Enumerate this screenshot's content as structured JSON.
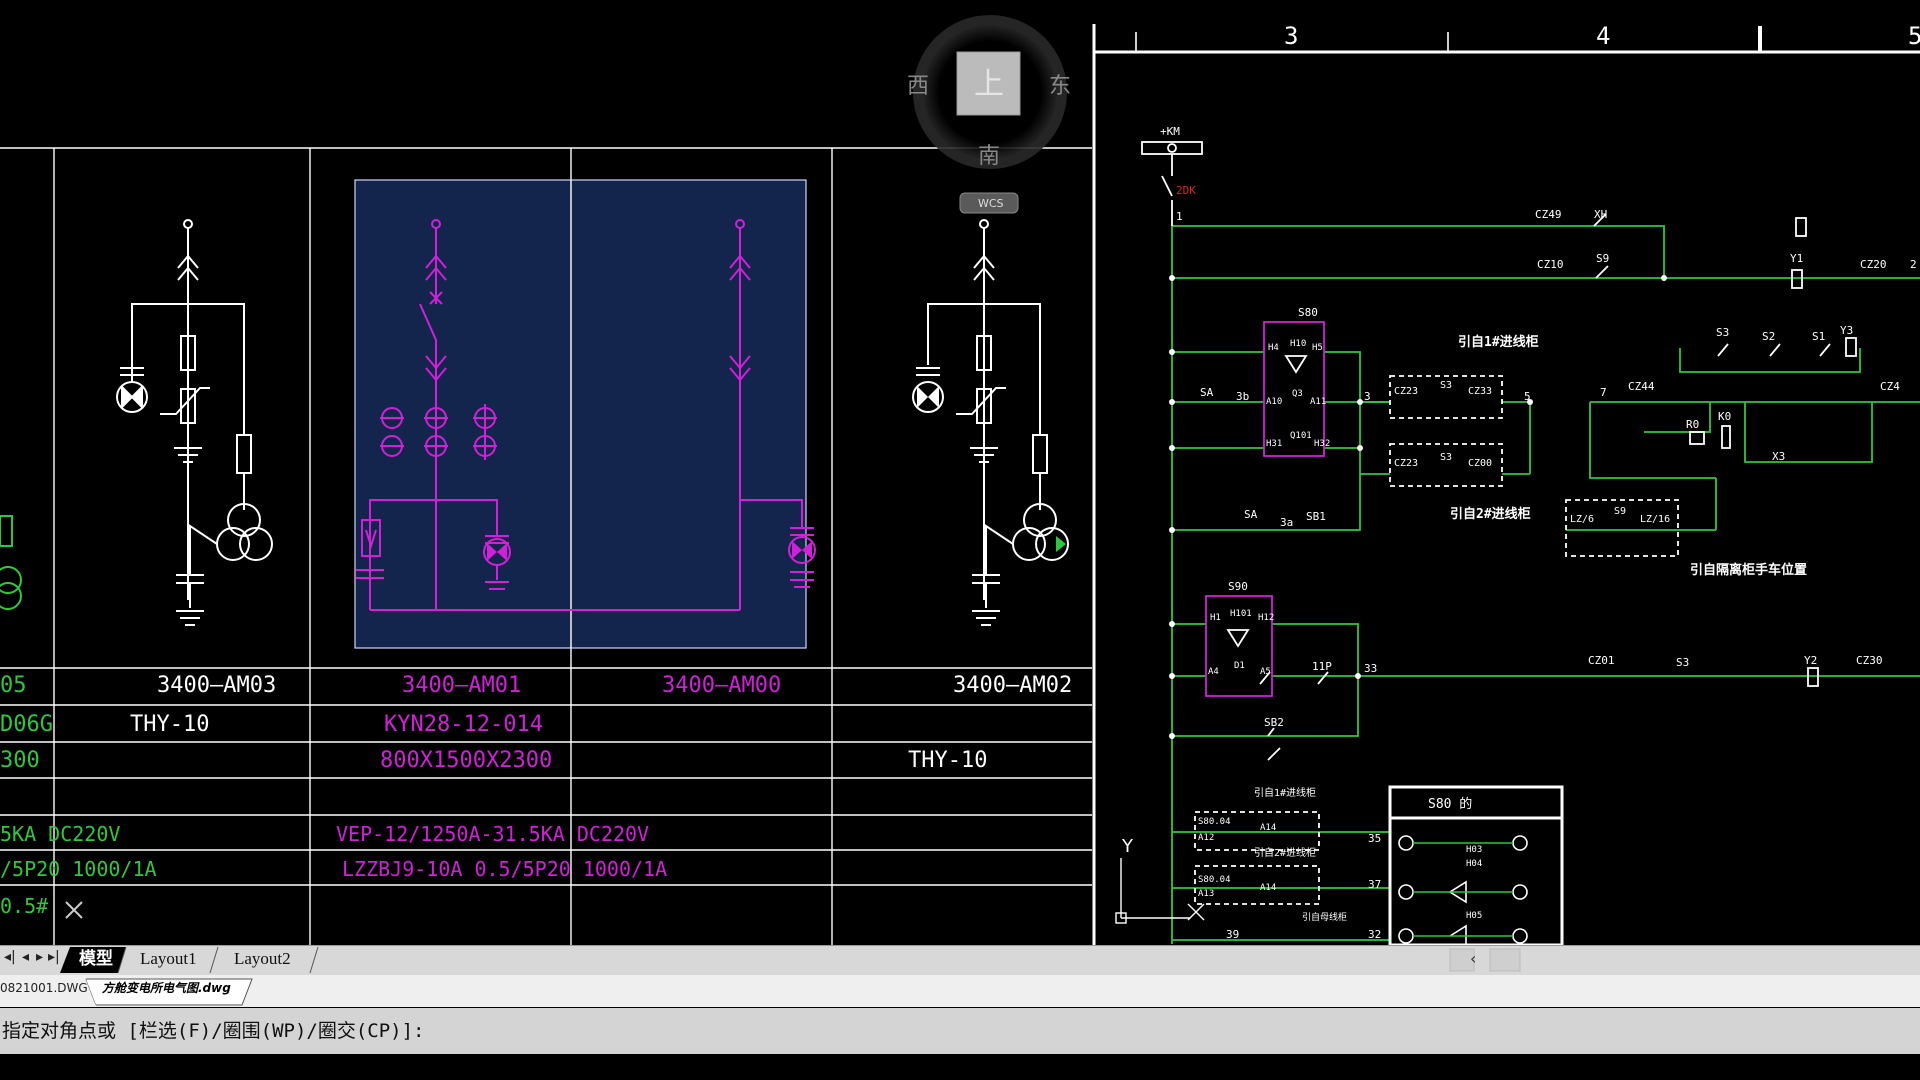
{
  "viewcube": {
    "top_label": "上",
    "west": "西",
    "east": "东",
    "south": "南",
    "wcs": "WCS"
  },
  "ruler": {
    "labels": [
      "3",
      "4",
      "5"
    ]
  },
  "panels": {
    "row1": [
      "05",
      "3400—AM03",
      "3400—AM01",
      "3400—AM00",
      "3400—AM02"
    ],
    "row2": [
      "D06G",
      "THY-10",
      "KYN28-12-014"
    ],
    "row3": [
      "300",
      "800X1500X2300",
      "THY-10"
    ],
    "row5": [
      "5KA DC220V",
      "VEP-12/1250A-31.5KA DC220V"
    ],
    "row6": [
      "/5P20 1000/1A",
      "LZZBJ9-10A 0.5/5P20 1000/1A"
    ],
    "row7": [
      "0.5#"
    ]
  },
  "schematic": {
    "supply": "+KM",
    "fuse": "2DK",
    "node1": "1",
    "labels": {
      "cz49": "CZ49",
      "xh": "XH",
      "cz10": "CZ10",
      "s9a": "S9",
      "y1": "Y1",
      "cz20": "CZ20",
      "e2": "2",
      "s80": "S80",
      "h4": "H4",
      "h10": "H10",
      "h5": "H5",
      "a10": "A10",
      "a11": "A11",
      "q3": "Q3",
      "h31": "H31",
      "q101": "Q101",
      "h32": "H32",
      "sa": "SA",
      "n3b": "3b",
      "n3": "3",
      "n5": "5",
      "ref1": "引自1#进线柜",
      "cz23a": "CZ23",
      "s3a": "S3",
      "cz33a": "CZ33",
      "cz23b": "CZ23",
      "s3b": "S3",
      "cz00b": "CZ00",
      "ref2": "引自2#进线柜",
      "n7": "7",
      "cz44": "CZ44",
      "s3c": "S3",
      "s2": "S2",
      "s1": "S1",
      "y3": "Y3",
      "r0": "R0",
      "k0": "K0",
      "x3": "X3",
      "cz4": "CZ4",
      "sa2": "SA",
      "n3a": "3a",
      "sb1": "SB1",
      "lz6": "LZ/6",
      "s9b": "S9",
      "lz16": "LZ/16",
      "ref3": "引自隔离柜手车位置",
      "s90": "S90",
      "h1": "H1",
      "h101": "H101",
      "h12": "H12",
      "a4": "A4",
      "d1": "D1",
      "a5": "A5",
      "n11p": "11P",
      "n33": "33",
      "cz01": "CZ01",
      "s3d": "S3",
      "y2": "Y2",
      "cz30": "CZ30",
      "sb2": "SB2",
      "s8004a": "S80.04",
      "a12": "A12",
      "a14": "A14",
      "ref4": "引自1#进线柜",
      "s8004b": "S80.04",
      "a13": "A13",
      "a14b": "A14",
      "ref5": "引自2#进线柜",
      "ref6": "引自母线柜",
      "n35": "35",
      "n37": "37",
      "n39": "39",
      "n32": "32",
      "s80box": "S80 的",
      "h03": "H03",
      "h04": "H04",
      "h05": "H05",
      "ucs_y": "Y"
    }
  },
  "tabs": {
    "model": "模型",
    "layout1": "Layout1",
    "layout2": "Layout2"
  },
  "files": {
    "file1": "0821001.DWG",
    "file2": "方舱变电所电气图.dwg"
  },
  "command": "指定对角点或 [栏选(F)/圈围(WP)/圈交(CP)]:",
  "colors": {
    "background": "#000000",
    "magenta": "#d020d8",
    "green": "#2ec83c",
    "selection": "#13254d",
    "statusbar": "#d4d4d4"
  }
}
